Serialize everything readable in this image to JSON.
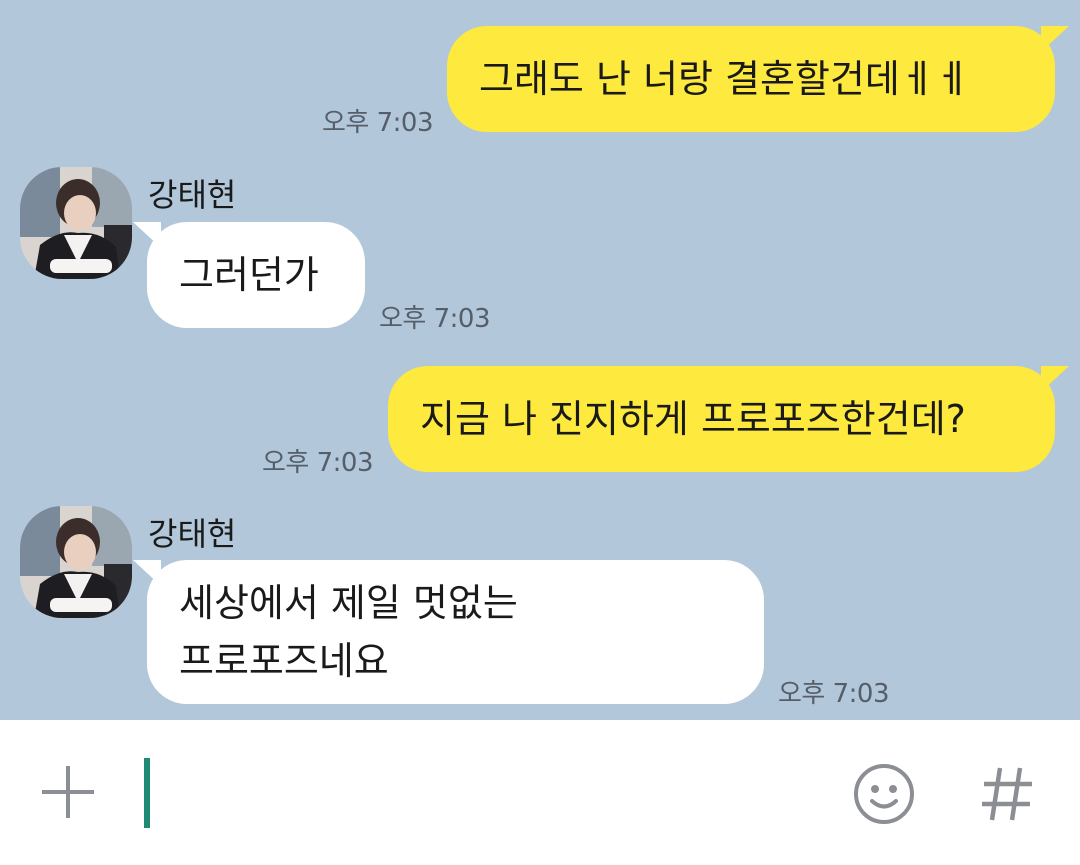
{
  "messages": [
    {
      "from": "me",
      "text_lines": [
        "그래도 난 너랑 결혼할건데ㅔㅔ"
      ],
      "time": "오후 7:03"
    },
    {
      "from": "them",
      "sender": "강태현",
      "text_lines": [
        "그러던가"
      ],
      "time": "오후 7:03"
    },
    {
      "from": "me",
      "text_lines": [
        "지금 나 진지하게 프로포즈한건데?"
      ],
      "time": "오후 7:03"
    },
    {
      "from": "them",
      "sender": "강태현",
      "text_lines": [
        "세상에서 제일 멋없는",
        "프로포즈네요"
      ],
      "time": "오후 7:03"
    }
  ],
  "input_bar": {
    "plus_icon": "plus-icon",
    "emoji_icon": "emoji-icon",
    "hash_icon": "hash-icon"
  },
  "colors": {
    "chat_background": "#b2c7da",
    "my_bubble": "#fee93e",
    "their_bubble": "#ffffff",
    "caret": "#1e8a74"
  }
}
